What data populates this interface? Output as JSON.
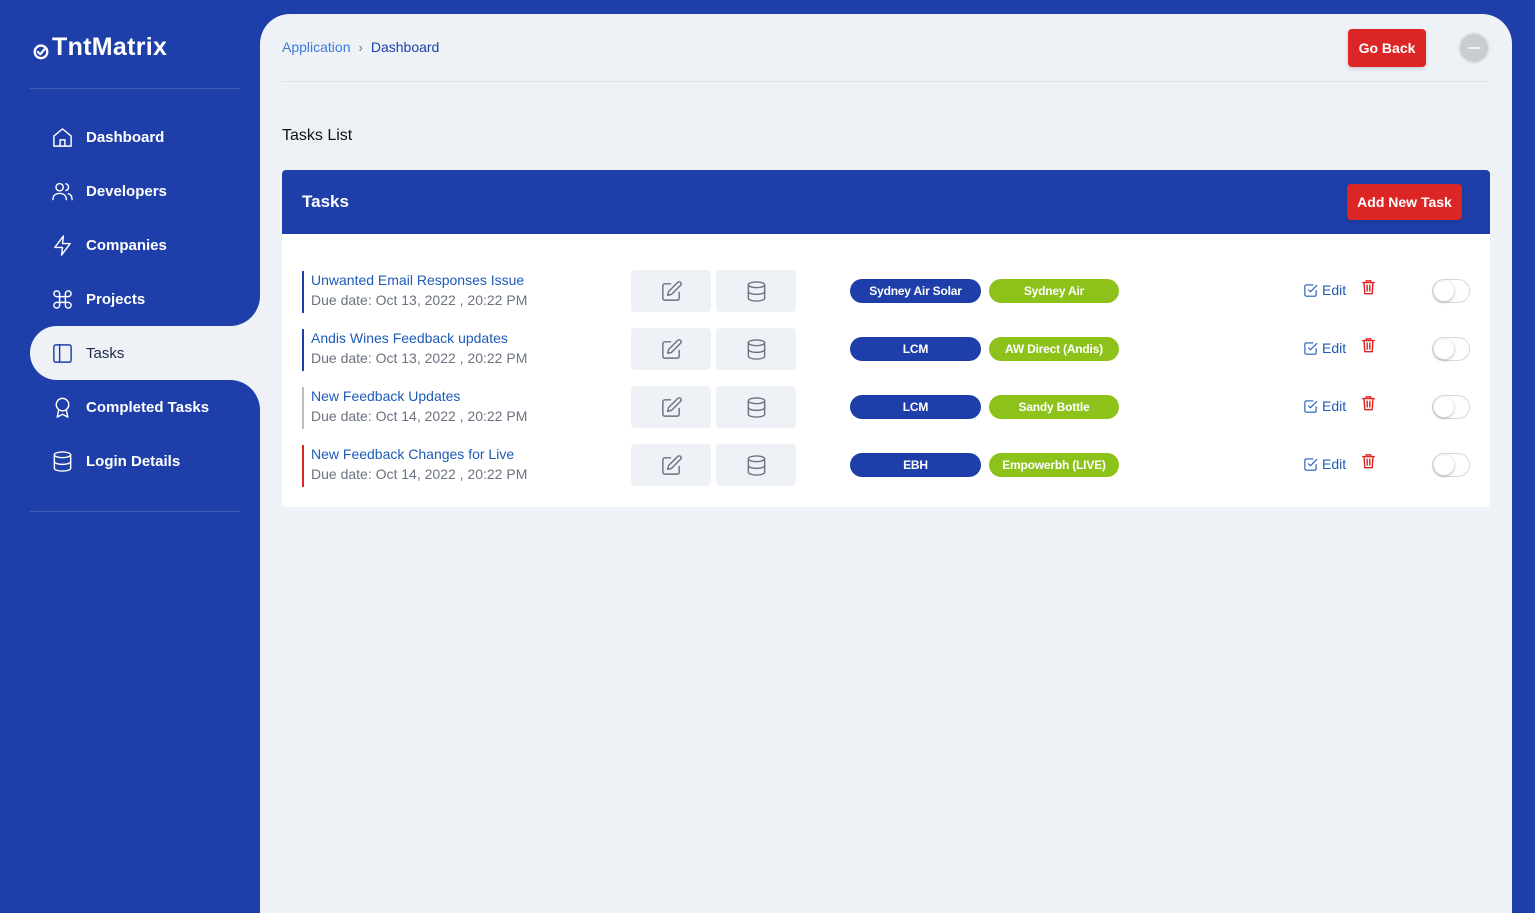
{
  "app": {
    "name": "TntMatrix"
  },
  "sidebar": {
    "items": [
      {
        "label": "Dashboard",
        "icon": "home-icon"
      },
      {
        "label": "Developers",
        "icon": "users-icon"
      },
      {
        "label": "Companies",
        "icon": "bolt-icon"
      },
      {
        "label": "Projects",
        "icon": "command-icon"
      },
      {
        "label": "Tasks",
        "icon": "columns-icon",
        "active": true
      },
      {
        "label": "Completed Tasks",
        "icon": "award-icon"
      },
      {
        "label": "Login Details",
        "icon": "database-icon"
      }
    ]
  },
  "header": {
    "breadcrumb": [
      "Application",
      "Dashboard"
    ],
    "go_back_label": "Go Back"
  },
  "page": {
    "title": "Tasks List"
  },
  "card": {
    "title": "Tasks",
    "add_button_label": "Add New Task",
    "edit_label": "Edit"
  },
  "tasks": [
    {
      "title": "Unwanted Email Responses Issue",
      "due": "Due date: Oct 13, 2022 , 20:22 PM",
      "badge1": "Sydney Air Solar",
      "badge2": "Sydney Air",
      "accent": "#1e3faa"
    },
    {
      "title": "Andis Wines Feedback updates",
      "due": "Due date: Oct 13, 2022 , 20:22 PM",
      "badge1": "LCM",
      "badge2": "AW Direct (Andis)",
      "accent": "#1e3faa"
    },
    {
      "title": "New Feedback Updates",
      "due": "Due date: Oct 14, 2022 , 20:22 PM",
      "badge1": "LCM",
      "badge2": "Sandy Bottle",
      "accent": "#b8bcc4"
    },
    {
      "title": "New Feedback Changes for Live",
      "due": "Due date: Oct 14, 2022 , 20:22 PM",
      "badge1": "EBH",
      "badge2": "Empowerbh (LIVE)",
      "accent": "#dc2626"
    }
  ],
  "colors": {
    "brand": "#1e3faa",
    "danger": "#dc2626",
    "success": "#8cc21a",
    "background": "#eef2f7"
  }
}
